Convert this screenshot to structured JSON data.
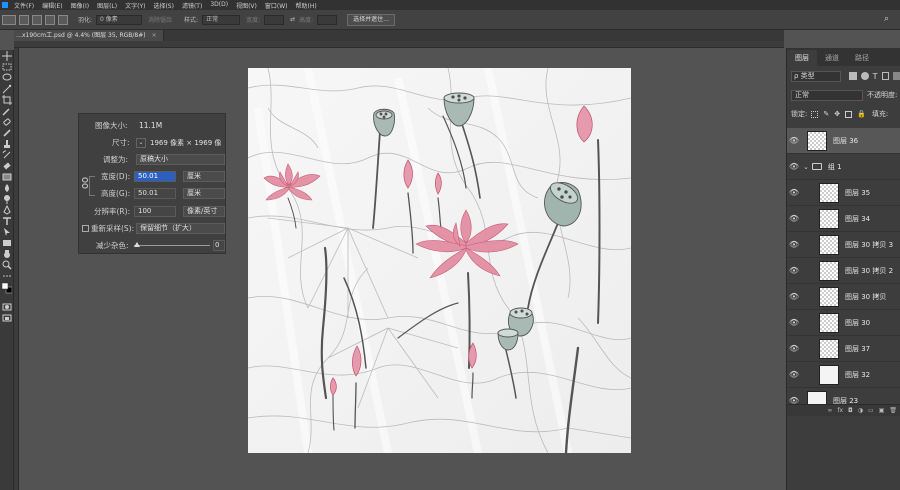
{
  "menubar": {
    "items": [
      "文件(F)",
      "编辑(E)",
      "图像(I)",
      "图层(L)",
      "文字(Y)",
      "选择(S)",
      "滤镜(T)",
      "3D(D)",
      "视图(V)",
      "窗口(W)",
      "帮助(H)"
    ]
  },
  "optbar": {
    "feather_label": "羽化:",
    "feather_value": "0 像素",
    "antialias_label": "消除锯齿",
    "style_label": "样式:",
    "style_value": "正常",
    "width_label": "宽度:",
    "height_label": "高度:",
    "select_mask_button": "选择并遮住..."
  },
  "document": {
    "tab_title": "…x190cm工.psd @ 4.4% (图层 35, RGB/8#)",
    "tab_close": "×"
  },
  "size_panel": {
    "image_size_label": "图像大小:",
    "image_size_value": "11.1M",
    "dimensions_label": "尺寸:",
    "dimensions_value": "1969 像素 × 1969 像",
    "fit_label": "调整为:",
    "fit_value": "原稿大小",
    "width_label": "宽度(D):",
    "width_value": "50.01",
    "width_unit": "厘米",
    "height_label": "高度(G):",
    "height_value": "50.01",
    "height_unit": "厘米",
    "resolution_label": "分辨率(R):",
    "resolution_value": "100",
    "resolution_unit": "像素/英寸",
    "resample_label": "重新采样(S):",
    "resample_value": "保留细节（扩大）",
    "noise_label": "减少杂色:",
    "noise_value": "0"
  },
  "layers_panel": {
    "tabs": [
      "图层",
      "通道",
      "路径"
    ],
    "filter_label": "ρ 类型",
    "blend_mode": "正常",
    "opacity_label": "不透明度:",
    "lock_label": "锁定:",
    "fill_label": "填充:",
    "layers": [
      {
        "name": "图层 36",
        "selected": true,
        "indent": 0,
        "thumb": "checker"
      },
      {
        "name": "组 1",
        "selected": false,
        "indent": 0,
        "thumb": "folder"
      },
      {
        "name": "图层 35",
        "selected": false,
        "indent": 1,
        "thumb": "checker"
      },
      {
        "name": "图层 34",
        "selected": false,
        "indent": 1,
        "thumb": "checker"
      },
      {
        "name": "图层 30 拷贝 3",
        "selected": false,
        "indent": 1,
        "thumb": "checker"
      },
      {
        "name": "图层 30 拷贝 2",
        "selected": false,
        "indent": 1,
        "thumb": "checker"
      },
      {
        "name": "图层 30 拷贝",
        "selected": false,
        "indent": 1,
        "thumb": "checker"
      },
      {
        "name": "图层 30",
        "selected": false,
        "indent": 1,
        "thumb": "checker"
      },
      {
        "name": "图层 37",
        "selected": false,
        "indent": 1,
        "thumb": "checker"
      },
      {
        "name": "图层 32",
        "selected": false,
        "indent": 1,
        "thumb": "plain"
      },
      {
        "name": "图层 23",
        "selected": false,
        "indent": 0,
        "thumb": "plain"
      }
    ],
    "bottom_icons": [
      "link-icon",
      "fx-icon",
      "mask-icon",
      "adjustment-icon",
      "folder-icon",
      "new-layer-icon",
      "trash-icon"
    ]
  },
  "colors": {
    "accent": "#2b5fc1",
    "lotus_pink": "#d9607a",
    "ink_gray": "#6a6a6a",
    "pod_green": "#9fb5ad"
  }
}
